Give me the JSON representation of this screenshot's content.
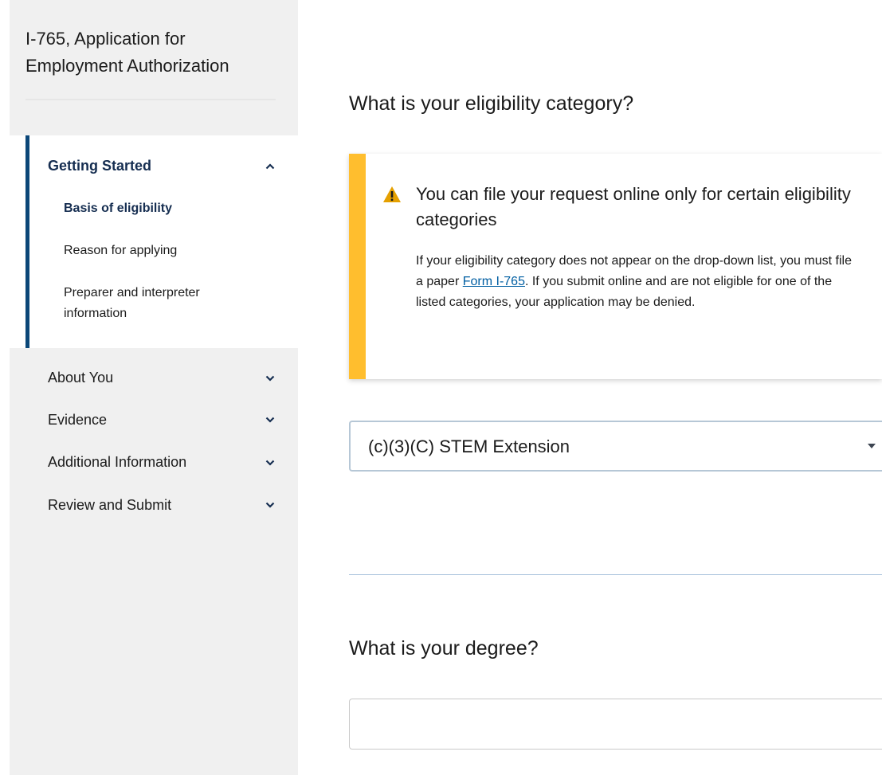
{
  "app": {
    "title": "I-765, Application for Employment Authorization"
  },
  "sidebar": {
    "sections": [
      {
        "label": "Getting Started",
        "expanded": true,
        "icon": "chevron-up-icon",
        "items": [
          {
            "label": "Basis of eligibility",
            "current": true
          },
          {
            "label": "Reason for applying",
            "current": false
          },
          {
            "label": "Preparer and interpreter information",
            "current": false
          }
        ]
      },
      {
        "label": "About You",
        "expanded": false,
        "icon": "chevron-down-icon"
      },
      {
        "label": "Evidence",
        "expanded": false,
        "icon": "chevron-down-icon"
      },
      {
        "label": "Additional Information",
        "expanded": false,
        "icon": "chevron-down-icon"
      },
      {
        "label": "Review and Submit",
        "expanded": false,
        "icon": "chevron-down-icon"
      }
    ]
  },
  "main": {
    "eligibility_heading": "What is your eligibility category?",
    "alert": {
      "icon": "warning-icon",
      "title": "You can file your request online only for certain eligibility categories",
      "body_before_link": "If your eligibility category does not appear on the drop-down list, you must file a paper ",
      "link_text": "Form I-765",
      "body_after_link": ". If you submit online and are not eligible for one of the listed categories, your application may be denied."
    },
    "eligibility_select": {
      "value": "(c)(3)(C) STEM Extension",
      "icon": "caret-down-icon"
    },
    "degree_heading": "What is your degree?",
    "degree_input": {
      "value": "",
      "placeholder": ""
    }
  },
  "colors": {
    "nav_accent": "#0b4778",
    "alert_stripe": "#ffbe2e",
    "link": "#005ea2",
    "sidebar_bg": "#f0f0f0"
  }
}
